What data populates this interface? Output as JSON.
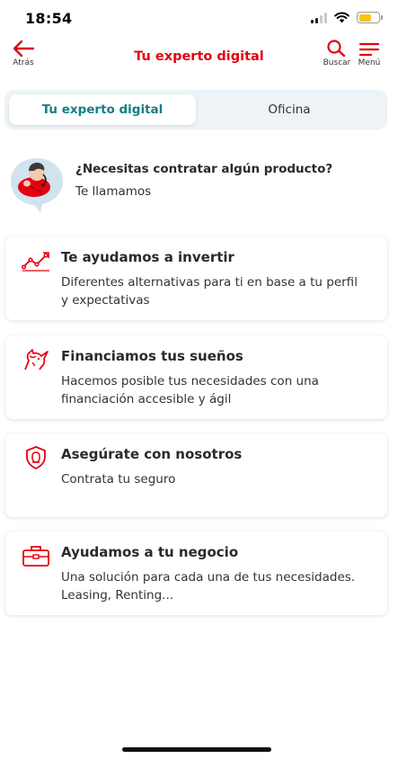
{
  "status_bar": {
    "time": "18:54",
    "battery_color": "#f5c518"
  },
  "header": {
    "back_label": "Atrás",
    "title": "Tu experto digital",
    "search_label": "Buscar",
    "menu_label": "Menú",
    "accent_color": "#e4000f"
  },
  "tabs": [
    {
      "label": "Tu experto digital",
      "active": true
    },
    {
      "label": "Oficina",
      "active": false
    }
  ],
  "call_banner": {
    "title": "¿Necesitas contratar algún producto?",
    "subtitle": "Te llamamos",
    "icon": "agent-avatar-icon"
  },
  "cards": [
    {
      "icon": "investment-chart-icon",
      "title": "Te ayudamos a invertir",
      "description": "Diferentes alternativas para ti en base a tu perfil y expectativas"
    },
    {
      "icon": "unicorn-icon",
      "title": "Financiamos tus sueños",
      "description": "Hacemos posible tus necesidades con una financiación accesible y ágil"
    },
    {
      "icon": "shield-icon",
      "title": "Asegúrate con nosotros",
      "description": "Contrata tu seguro"
    },
    {
      "icon": "briefcase-icon",
      "title": "Ayudamos a tu negocio",
      "description": "Una solución para cada una de tus necesidades. Leasing, Renting..."
    }
  ]
}
